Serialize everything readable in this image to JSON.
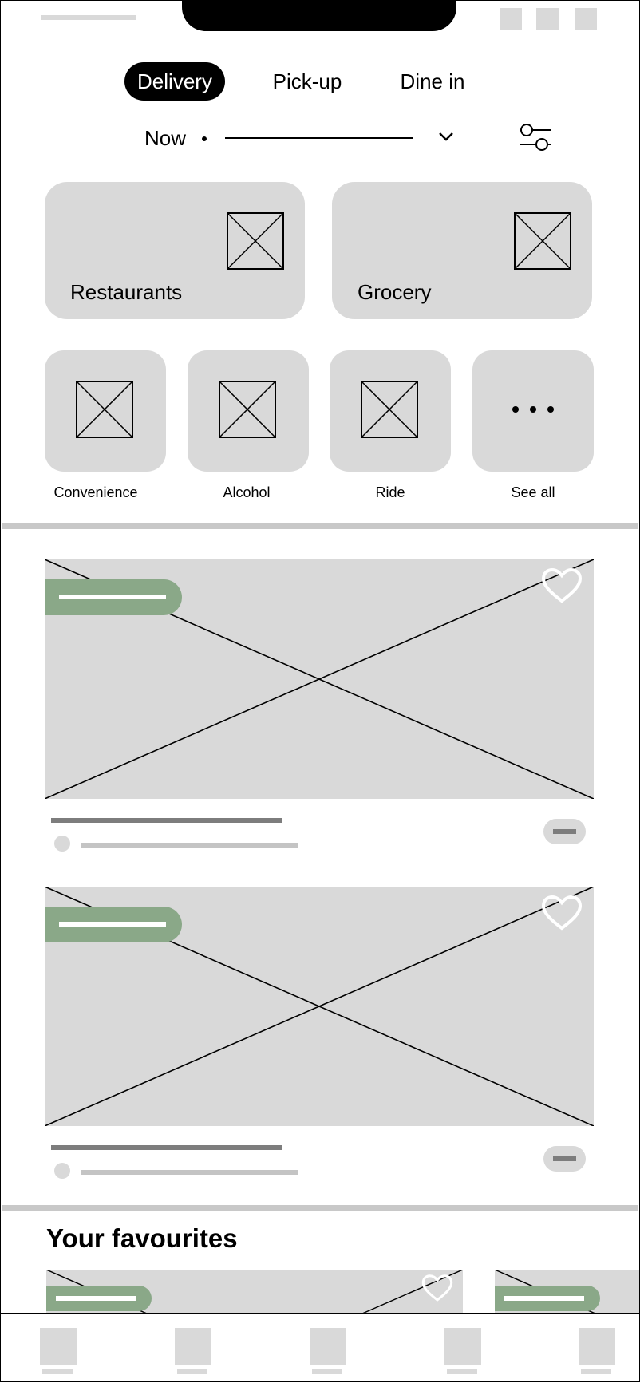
{
  "status_bar": {
    "icons": [
      "status-square-icon",
      "status-square-icon",
      "status-square-icon"
    ]
  },
  "mode_tabs": [
    {
      "label": "Delivery",
      "active": true
    },
    {
      "label": "Pick-up",
      "active": false
    },
    {
      "label": "Dine in",
      "active": false
    }
  ],
  "schedule": {
    "time_label": "Now",
    "dropdown_icon": "chevron-down-icon",
    "filter_icon": "filter-sliders-icon"
  },
  "categories_main": [
    {
      "label": "Restaurants",
      "icon": "image-placeholder-icon"
    },
    {
      "label": "Grocery",
      "icon": "image-placeholder-icon"
    }
  ],
  "categories_secondary": [
    {
      "label": "Convenience",
      "icon": "image-placeholder-icon"
    },
    {
      "label": "Alcohol",
      "icon": "image-placeholder-icon"
    },
    {
      "label": "Ride",
      "icon": "image-placeholder-icon"
    },
    {
      "label": "See all",
      "icon": "more-dots-icon"
    }
  ],
  "feed": {
    "card_count": 2,
    "promo_color": "#8aa888",
    "favorite_icon": "heart-icon"
  },
  "favourites": {
    "title": "Your favourites"
  },
  "bottom_nav": {
    "item_count": 5
  }
}
